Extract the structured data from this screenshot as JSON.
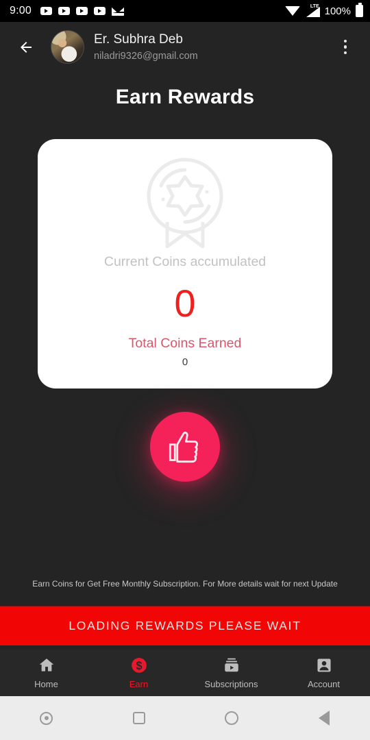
{
  "statusbar": {
    "time": "9:00",
    "notification_icons": [
      "youtube-icon",
      "youtube-icon",
      "youtube-icon",
      "youtube-icon",
      "mail-icon"
    ],
    "wifi_icon": "wifi-icon",
    "network_type": "LTE",
    "battery_percent": "100%",
    "battery_icon": "battery-full-icon"
  },
  "appbar": {
    "back_icon": "back-arrow-icon",
    "avatar": "user-avatar",
    "user_name": "Er. Subhra Deb",
    "user_email": "niladri9326@gmail.com",
    "overflow_icon": "more-vertical-icon"
  },
  "page": {
    "title": "Earn Rewards"
  },
  "card": {
    "award_icon": "award-badge-icon",
    "current_label": "Current Coins accumulated",
    "current_value": "0",
    "total_label": "Total Coins Earned",
    "total_value": "0",
    "value_color": "#ef2020",
    "total_label_color": "#d9566b"
  },
  "fab": {
    "icon": "thumbs-up-icon",
    "color": "#f5225a"
  },
  "note": {
    "text": "Earn Coins for Get Free Monthly Subscription. For More details wait for next Update"
  },
  "loading_button": {
    "label": "LOADING REWARDS PLEASE WAIT",
    "color": "#f20505"
  },
  "bottomnav": {
    "active": "Earn",
    "active_color": "#e8192c",
    "items": [
      {
        "label": "Home",
        "icon": "home-icon"
      },
      {
        "label": "Earn",
        "icon": "dollar-coin-icon"
      },
      {
        "label": "Subscriptions",
        "icon": "subscriptions-icon"
      },
      {
        "label": "Account",
        "icon": "account-icon"
      }
    ]
  },
  "sysnav": {
    "items": [
      {
        "icon": "assistant-dot-icon"
      },
      {
        "icon": "recents-square-icon"
      },
      {
        "icon": "home-circle-icon"
      },
      {
        "icon": "back-triangle-icon"
      }
    ]
  }
}
